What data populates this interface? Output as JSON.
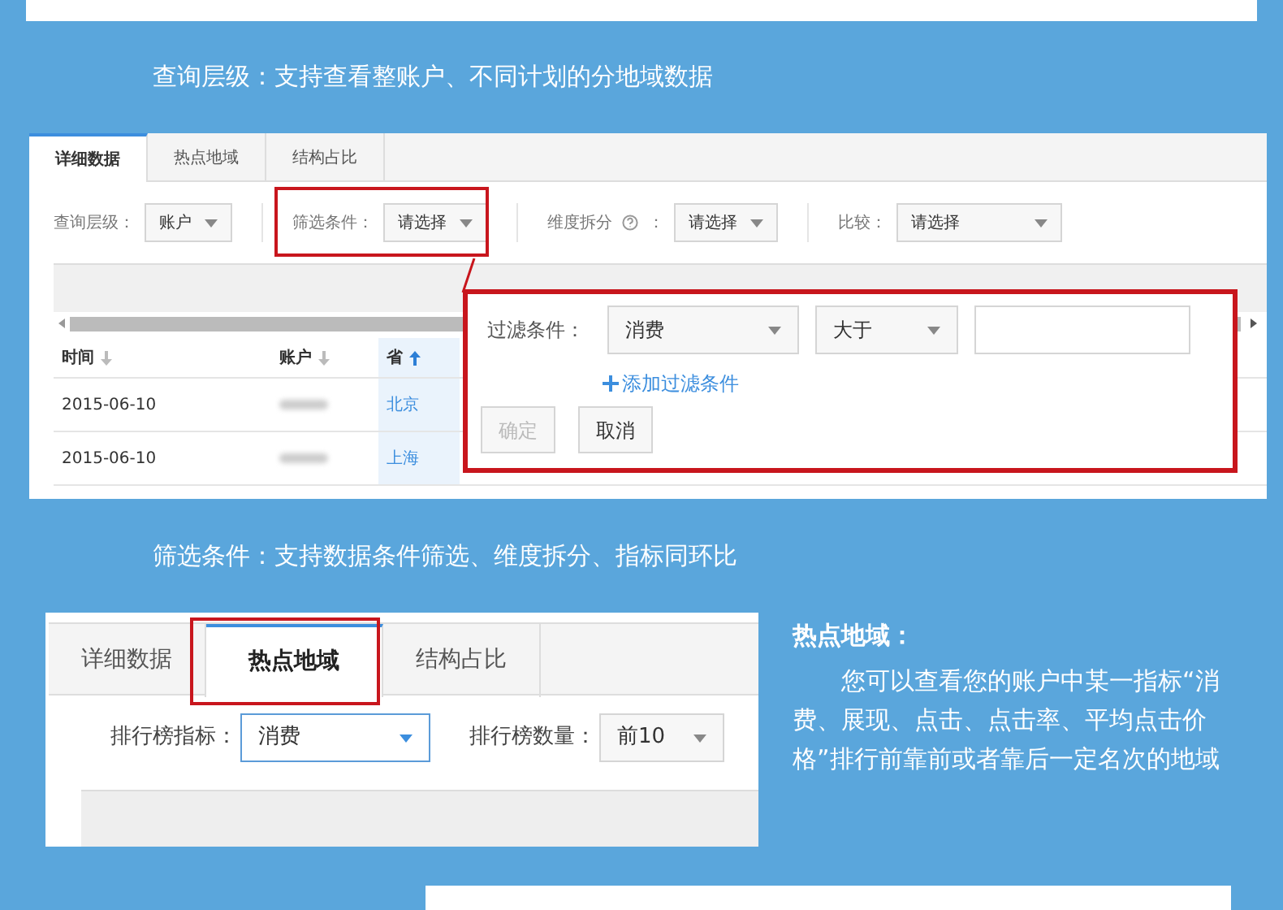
{
  "heading_1": "查询层级：支持查看整账户、不同计划的分地域数据",
  "screenshot_1": {
    "tabs": [
      {
        "label": "详细数据",
        "selected": true
      },
      {
        "label": "热点地域",
        "selected": false
      },
      {
        "label": "结构占比",
        "selected": false
      }
    ],
    "filters": [
      {
        "label": "查询层级：",
        "value": "账户",
        "kind": "compact",
        "help": false,
        "highlighted": false
      },
      {
        "label": "筛选条件：",
        "value": "请选择",
        "kind": "compact",
        "help": false,
        "highlighted": true
      },
      {
        "label": "维度拆分",
        "value": "请选择",
        "kind": "compact",
        "help": true,
        "highlighted": false
      },
      {
        "label": "比较：",
        "value": "请选择",
        "kind": "wide",
        "help": false,
        "highlighted": false
      }
    ],
    "help_colon": "：",
    "columns": [
      {
        "label": "时间",
        "sort_ascending": false,
        "sort_active": false
      },
      {
        "label": "账户",
        "sort_ascending": false,
        "sort_active": false
      },
      {
        "label": "省",
        "sort_ascending": true,
        "sort_active": true
      }
    ],
    "rows": [
      {
        "cells": [
          {
            "kind": "text",
            "text": "2015-06-10"
          },
          {
            "kind": "blurred"
          },
          {
            "kind": "link",
            "text": "北京"
          }
        ]
      },
      {
        "cells": [
          {
            "kind": "text",
            "text": "2015-06-10"
          },
          {
            "kind": "blurred"
          },
          {
            "kind": "link",
            "text": "上海"
          }
        ]
      }
    ],
    "filter_popup": {
      "label": "过滤条件：",
      "field": "消费",
      "operator": "大于",
      "add_link": "添加过滤条件",
      "buttons": [
        {
          "label": "确定",
          "disabled": true
        },
        {
          "label": "取消",
          "disabled": false
        }
      ]
    }
  },
  "heading_2": "筛选条件：支持数据条件筛选、维度拆分、指标同环比",
  "screenshot_2": {
    "tabs": [
      {
        "label": "详细数据",
        "selected": false
      },
      {
        "label": "热点地域",
        "selected": true
      },
      {
        "label": "结构占比",
        "selected": false
      }
    ],
    "filters": [
      {
        "label": "排行榜指标：",
        "value": "消费",
        "focused": true
      },
      {
        "label": "排行榜数量：",
        "value": "前10",
        "focused": false
      }
    ]
  },
  "note": {
    "title": "热点地域：",
    "body": "您可以查看您的账户中某一指标“消费、展现、点击、点击率、平均点击价格”排行前靠前或者靠后一定名次的地域"
  }
}
